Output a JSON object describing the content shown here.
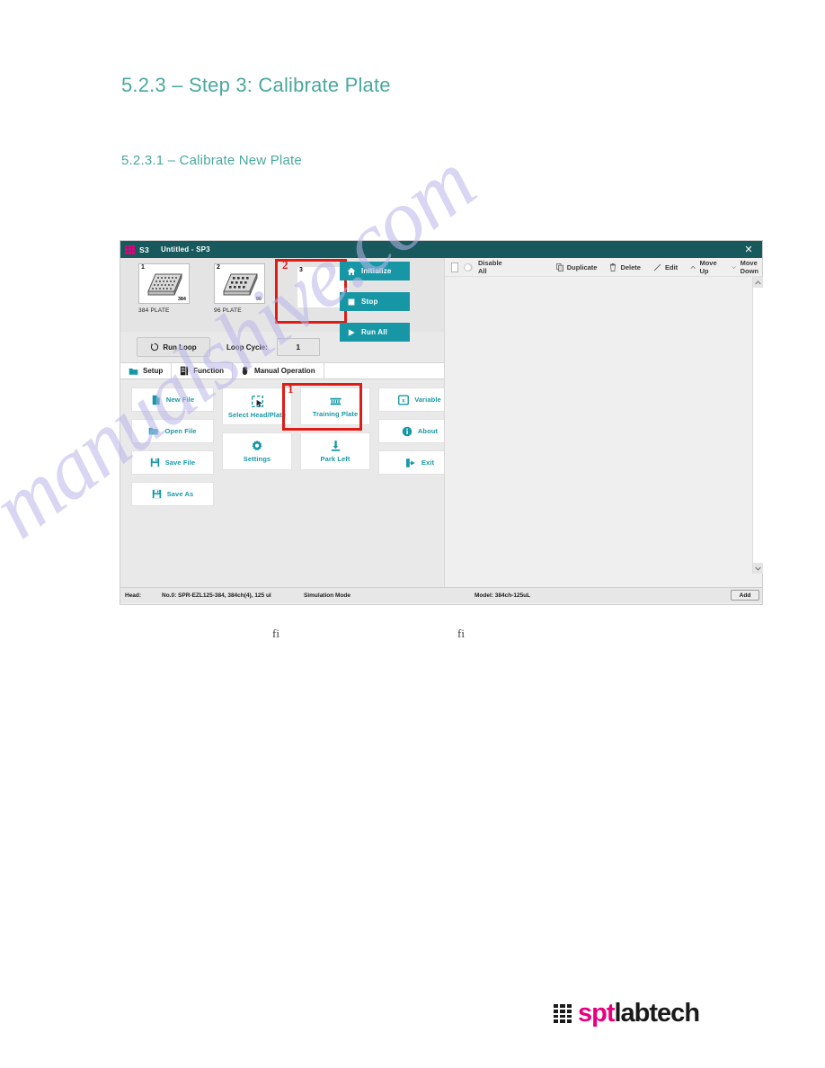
{
  "document": {
    "heading": "5.2.3 – Step 3: Calibrate Plate",
    "subheading": "5.2.3.1 – Calibrate New Plate",
    "stray_glyph_1": "fi",
    "stray_glyph_2": "fi",
    "watermark": "manualshive.com"
  },
  "colors": {
    "heading_teal": "#4aa89e",
    "titlebar": "#17595c",
    "accent_teal": "#1797A6",
    "annotation_red": "#e01b15",
    "brand_magenta": "#e6007e"
  },
  "app": {
    "titlebar": {
      "app_name": "S3",
      "document_title": "Untitled - SP3",
      "close_label": "✕",
      "logo_icon": "dot-grid-icon"
    },
    "plates": [
      {
        "index": "1",
        "count_label": "384",
        "caption": "384 PLATE",
        "empty": false
      },
      {
        "index": "2",
        "count_label": "96",
        "caption": "96 PLATE",
        "empty": false
      },
      {
        "index": "3",
        "count_label": "",
        "caption": "",
        "empty": true
      }
    ],
    "action_buttons": [
      {
        "label": "Initialize",
        "icon": "home-icon"
      },
      {
        "label": "Stop",
        "icon": "stop-square-icon"
      },
      {
        "label": "Run All",
        "icon": "play-triangle-icon"
      }
    ],
    "loop_row": {
      "run_loop_label": "Run Loop",
      "run_loop_icon": "refresh-circle-icon",
      "loop_cycle_label": "Loop Cycle:",
      "loop_cycle_value": "1"
    },
    "tabs": [
      {
        "label": "Setup",
        "icon": "folder-icon",
        "active": true
      },
      {
        "label": "Function",
        "icon": "list-document-icon",
        "active": false
      },
      {
        "label": "Manual Operation",
        "icon": "hand-icon",
        "active": false
      }
    ],
    "function_buttons": {
      "column_1": [
        {
          "label": "New File",
          "icon": "new-file-icon"
        },
        {
          "label": "Open File",
          "icon": "open-folder-icon"
        },
        {
          "label": "Save File",
          "icon": "floppy-disk-icon"
        },
        {
          "label": "Save As",
          "icon": "floppy-disk-icon"
        }
      ],
      "column_2": [
        {
          "label": "Select Head/Plate",
          "icon": "cursor-select-icon"
        },
        {
          "label": "Settings",
          "icon": "gear-icon"
        }
      ],
      "column_3": [
        {
          "label": "Training Plate",
          "icon": "plate-rack-icon"
        },
        {
          "label": "Park Left",
          "icon": "park-arrow-icon"
        }
      ],
      "column_4": [
        {
          "label": "Variable",
          "icon": "variable-box-icon"
        },
        {
          "label": "About",
          "icon": "info-circle-icon"
        },
        {
          "label": "Exit",
          "icon": "exit-door-icon"
        }
      ]
    },
    "right_toolbar": {
      "disable_all_label": "Disable All",
      "checkbox_checked": false,
      "toggle_on": false,
      "items": [
        {
          "label": "Duplicate",
          "icon": "duplicate-icon"
        },
        {
          "label": "Delete",
          "icon": "trash-icon"
        },
        {
          "label": "Edit",
          "icon": "pencil-icon"
        },
        {
          "label": "Move Up",
          "icon": "chevron-up-icon"
        },
        {
          "label": "Move Down",
          "icon": "chevron-down-icon"
        }
      ]
    },
    "statusbar": {
      "head_label": "Head:",
      "head_value": "No.0: SPR-EZL125-384, 384ch(4), 125 ul",
      "mode": "Simulation Mode",
      "model": "Model: 384ch-125uL",
      "add_button": "Add"
    }
  },
  "annotations": [
    {
      "number": "1",
      "target": "Training Plate"
    },
    {
      "number": "2",
      "target": "empty plate slot 3"
    }
  ],
  "footer": {
    "brand_first": "spt",
    "brand_second": "labtech",
    "logo_icon": "dot-grid-icon"
  }
}
